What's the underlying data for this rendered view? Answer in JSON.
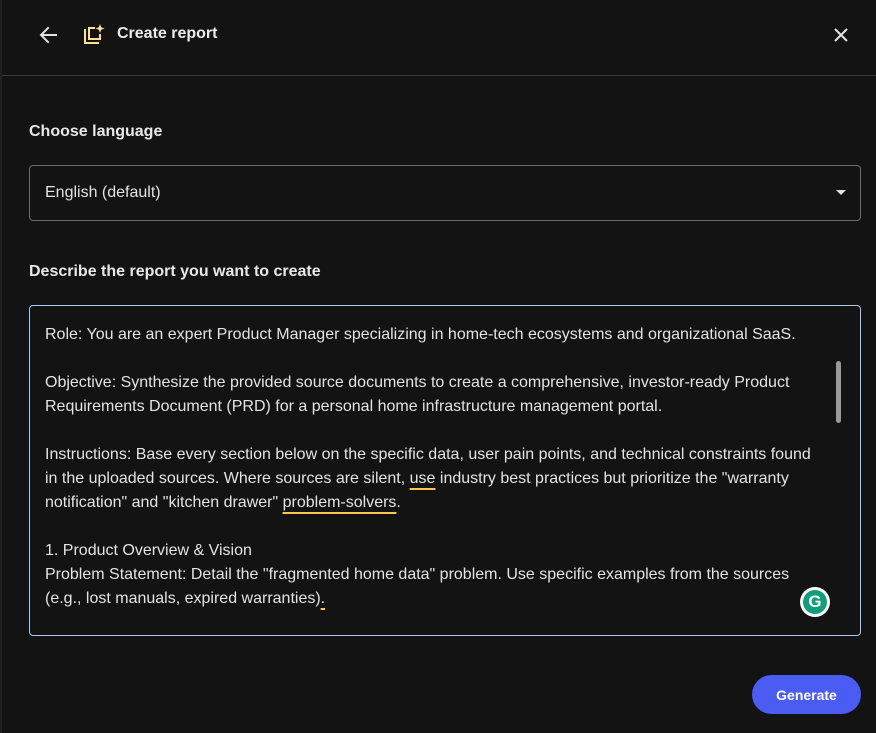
{
  "header": {
    "title": "Create report",
    "back_icon": "arrow-back-icon",
    "report_icon": "report-sparkle-icon",
    "close_icon": "close-icon"
  },
  "language": {
    "label": "Choose language",
    "selected": "English (default)"
  },
  "description": {
    "label": "Describe the report you want to create",
    "paragraphs": {
      "role": "Role: You are an expert Product Manager specializing in home-tech ecosystems and organizational SaaS.",
      "objective": "Objective: Synthesize the provided source documents to create a comprehensive, investor-ready Product Requirements Document (PRD) for a personal home infrastructure management portal.",
      "instructions_a": "Instructions: Base every section below on the specific data, user pain points, and technical constraints found in the uploaded sources. Where sources are silent, ",
      "instructions_use": "use",
      "instructions_b": " industry best practices but prioritize the \"warranty notification\" and \"kitchen drawer\" ",
      "instructions_ps": "problem-solvers",
      "instructions_end": ".",
      "section_heading": "1. Product Overview & Vision",
      "problem_a": "Problem Statement: Detail the \"fragmented home data\" problem. Use specific examples from the sources (e.g., lost manuals, expired warranties)",
      "problem_end": "."
    }
  },
  "grammarly": {
    "letter": "G"
  },
  "footer": {
    "generate_label": "Generate"
  },
  "colors": {
    "accent_button": "#4b5cf2",
    "focus_border": "#a8c7fa",
    "underline": "#f9c74f",
    "background": "#131313"
  }
}
